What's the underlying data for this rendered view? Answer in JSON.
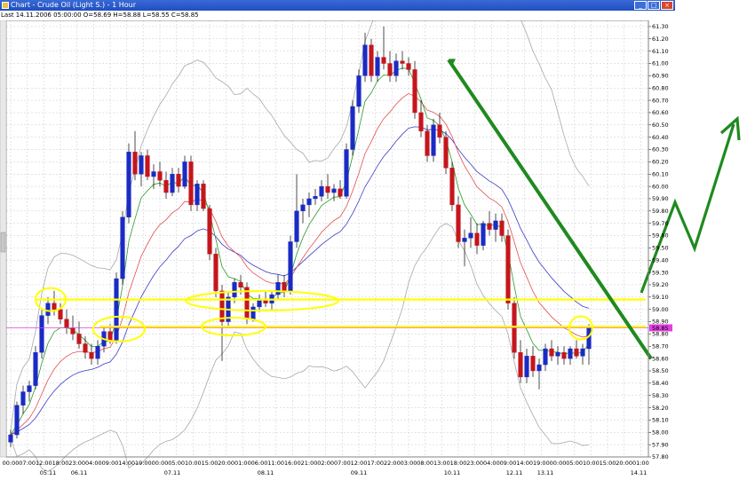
{
  "window": {
    "title": "Chart - Crude Oil (Light S.) - 1 Hour",
    "minimize": "_",
    "maximize": "□",
    "close": "×"
  },
  "status_line": "Last 14.11.2006 05:00:00 O=58.69 H=58.88 L=58.55 C=58.85",
  "colors": {
    "up_candle": "#1a2bc4",
    "down_candle": "#c4161c",
    "ma_fast": "#2a9a2a",
    "ma_mid": "#e05050",
    "ma_slow": "#3c3cc8",
    "bollinger": "#a8a8a8",
    "highlight": "#ffff00",
    "trend": "#1f8a1f",
    "current_price": "#e040e0",
    "grid": "#c8c8c8"
  },
  "chart_data": {
    "type": "candlestick",
    "symbol": "Crude Oil (Light S.)",
    "timeframe": "1 Hour",
    "ylim": [
      57.8,
      61.35
    ],
    "y_ticks": [
      "61.30",
      "61.20",
      "61.10",
      "61.00",
      "60.90",
      "60.80",
      "60.70",
      "60.60",
      "60.50",
      "60.40",
      "60.30",
      "60.20",
      "60.10",
      "60.00",
      "59.90",
      "59.80",
      "59.70",
      "59.60",
      "59.50",
      "59.40",
      "59.30",
      "59.20",
      "59.10",
      "59.00",
      "58.90",
      "58.80",
      "58.70",
      "58.60",
      "58.50",
      "58.40",
      "58.30",
      "58.20",
      "58.10",
      "58.00",
      "57.90",
      "57.80"
    ],
    "current_price_label": "58.85",
    "current_price": 58.85,
    "x_time_ticks": [
      "00:00",
      "07:00",
      "12:00",
      "18:00",
      "23:00",
      "04:00",
      "09:00",
      "14:00",
      "19:00",
      "00:00",
      "05:00",
      "10:00",
      "15:00",
      "20:00",
      "01:00",
      "06:00",
      "11:00",
      "16:00",
      "21:00",
      "02:00",
      "07:00",
      "12:00",
      "17:00",
      "22:00",
      "03:00",
      "08:00",
      "13:00",
      "18:00",
      "23:00",
      "04:00",
      "09:00",
      "14:00",
      "19:00",
      "00:00",
      "05:00",
      "10:00",
      "15:00",
      "20:00",
      "01:00"
    ],
    "x_date_ticks": [
      {
        "label": "05.11",
        "index": 6
      },
      {
        "label": "06.11",
        "index": 11
      },
      {
        "label": "07.11",
        "index": 26
      },
      {
        "label": "08.11",
        "index": 41
      },
      {
        "label": "09.11",
        "index": 56
      },
      {
        "label": "10.11",
        "index": 71
      },
      {
        "label": "12.11",
        "index": 81
      },
      {
        "label": "13.11",
        "index": 86
      },
      {
        "label": "14.11",
        "index": 101
      }
    ],
    "candles_ohlc": [
      [
        57.92,
        58.02,
        57.88,
        57.98
      ],
      [
        57.98,
        58.25,
        57.95,
        58.22
      ],
      [
        58.22,
        58.38,
        58.15,
        58.33
      ],
      [
        58.33,
        58.42,
        58.25,
        58.38
      ],
      [
        58.38,
        58.7,
        58.35,
        58.65
      ],
      [
        58.65,
        59.0,
        58.6,
        58.95
      ],
      [
        58.95,
        59.1,
        58.88,
        59.05
      ],
      [
        59.05,
        59.15,
        58.95,
        59.0
      ],
      [
        59.0,
        59.05,
        58.88,
        58.92
      ],
      [
        58.92,
        59.0,
        58.8,
        58.85
      ],
      [
        58.85,
        58.95,
        58.75,
        58.8
      ],
      [
        58.8,
        58.9,
        58.68,
        58.72
      ],
      [
        58.72,
        58.78,
        58.6,
        58.65
      ],
      [
        58.65,
        58.72,
        58.55,
        58.6
      ],
      [
        58.6,
        58.75,
        58.55,
        58.7
      ],
      [
        58.7,
        58.85,
        58.65,
        58.82
      ],
      [
        58.82,
        58.88,
        58.72,
        58.75
      ],
      [
        58.75,
        59.3,
        58.72,
        59.25
      ],
      [
        59.25,
        59.8,
        59.2,
        59.75
      ],
      [
        59.75,
        60.35,
        59.7,
        60.28
      ],
      [
        60.28,
        60.45,
        60.05,
        60.1
      ],
      [
        60.1,
        60.28,
        60.0,
        60.25
      ],
      [
        60.25,
        60.3,
        60.05,
        60.08
      ],
      [
        60.08,
        60.18,
        59.98,
        60.12
      ],
      [
        60.12,
        60.2,
        60.0,
        60.05
      ],
      [
        60.05,
        60.12,
        59.9,
        59.95
      ],
      [
        59.95,
        60.15,
        59.92,
        60.1
      ],
      [
        60.1,
        60.15,
        59.95,
        60.0
      ],
      [
        60.0,
        60.25,
        59.98,
        60.2
      ],
      [
        60.2,
        60.25,
        59.8,
        59.85
      ],
      [
        59.85,
        60.05,
        59.8,
        60.02
      ],
      [
        60.02,
        60.05,
        59.8,
        59.82
      ],
      [
        59.82,
        59.85,
        59.4,
        59.45
      ],
      [
        59.45,
        59.5,
        59.1,
        59.15
      ],
      [
        59.15,
        59.2,
        58.58,
        58.9
      ],
      [
        58.9,
        59.15,
        58.85,
        59.1
      ],
      [
        59.1,
        59.25,
        59.05,
        59.22
      ],
      [
        59.22,
        59.28,
        59.12,
        59.18
      ],
      [
        59.18,
        59.22,
        58.88,
        58.92
      ],
      [
        58.92,
        59.05,
        58.9,
        59.02
      ],
      [
        59.02,
        59.12,
        58.98,
        59.08
      ],
      [
        59.08,
        59.15,
        59.02,
        59.05
      ],
      [
        59.05,
        59.15,
        59.0,
        59.12
      ],
      [
        59.12,
        59.28,
        59.08,
        59.22
      ],
      [
        59.22,
        59.28,
        59.1,
        59.15
      ],
      [
        59.15,
        59.6,
        59.12,
        59.55
      ],
      [
        59.55,
        60.1,
        59.5,
        59.8
      ],
      [
        59.8,
        59.9,
        59.7,
        59.85
      ],
      [
        59.85,
        59.95,
        59.75,
        59.9
      ],
      [
        59.9,
        59.98,
        59.85,
        59.92
      ],
      [
        59.92,
        60.05,
        59.88,
        60.0
      ],
      [
        60.0,
        60.1,
        59.9,
        59.95
      ],
      [
        59.95,
        60.02,
        59.88,
        59.98
      ],
      [
        59.98,
        60.05,
        59.9,
        59.92
      ],
      [
        59.92,
        60.35,
        59.9,
        60.3
      ],
      [
        60.3,
        60.7,
        60.25,
        60.65
      ],
      [
        60.65,
        60.95,
        60.6,
        60.9
      ],
      [
        60.9,
        61.25,
        60.85,
        61.15
      ],
      [
        61.15,
        61.2,
        60.85,
        60.9
      ],
      [
        60.9,
        61.1,
        60.85,
        61.05
      ],
      [
        61.05,
        61.3,
        60.95,
        61.0
      ],
      [
        61.0,
        61.1,
        60.85,
        60.9
      ],
      [
        60.9,
        61.08,
        60.85,
        61.02
      ],
      [
        61.02,
        61.1,
        60.95,
        61.0
      ],
      [
        61.0,
        61.05,
        60.9,
        60.95
      ],
      [
        60.95,
        61.02,
        60.55,
        60.6
      ],
      [
        60.6,
        60.7,
        60.4,
        60.45
      ],
      [
        60.45,
        60.5,
        60.2,
        60.25
      ],
      [
        60.25,
        60.55,
        60.2,
        60.5
      ],
      [
        60.5,
        60.6,
        60.35,
        60.4
      ],
      [
        60.4,
        60.45,
        60.1,
        60.15
      ],
      [
        60.15,
        60.2,
        59.8,
        59.85
      ],
      [
        59.85,
        59.92,
        59.5,
        59.55
      ],
      [
        59.55,
        59.65,
        59.35,
        59.58
      ],
      [
        59.58,
        59.75,
        59.5,
        59.62
      ],
      [
        59.62,
        59.7,
        59.45,
        59.52
      ],
      [
        59.52,
        59.72,
        59.48,
        59.7
      ],
      [
        59.7,
        59.8,
        59.6,
        59.65
      ],
      [
        59.65,
        59.78,
        59.55,
        59.72
      ],
      [
        59.72,
        59.78,
        59.55,
        59.6
      ],
      [
        59.6,
        59.65,
        59.0,
        59.05
      ],
      [
        59.05,
        59.1,
        58.6,
        58.65
      ],
      [
        58.65,
        58.75,
        58.4,
        58.45
      ],
      [
        58.45,
        58.68,
        58.4,
        58.62
      ],
      [
        58.62,
        58.7,
        58.45,
        58.5
      ],
      [
        58.5,
        58.6,
        58.35,
        58.55
      ],
      [
        58.55,
        58.72,
        58.5,
        58.68
      ],
      [
        58.68,
        58.75,
        58.58,
        58.62
      ],
      [
        58.62,
        58.7,
        58.55,
        58.65
      ],
      [
        58.65,
        58.7,
        58.55,
        58.6
      ],
      [
        58.6,
        58.7,
        58.55,
        58.68
      ],
      [
        58.68,
        58.75,
        58.6,
        58.62
      ],
      [
        58.62,
        58.72,
        58.55,
        58.68
      ],
      [
        58.68,
        58.88,
        58.55,
        58.85
      ]
    ]
  }
}
